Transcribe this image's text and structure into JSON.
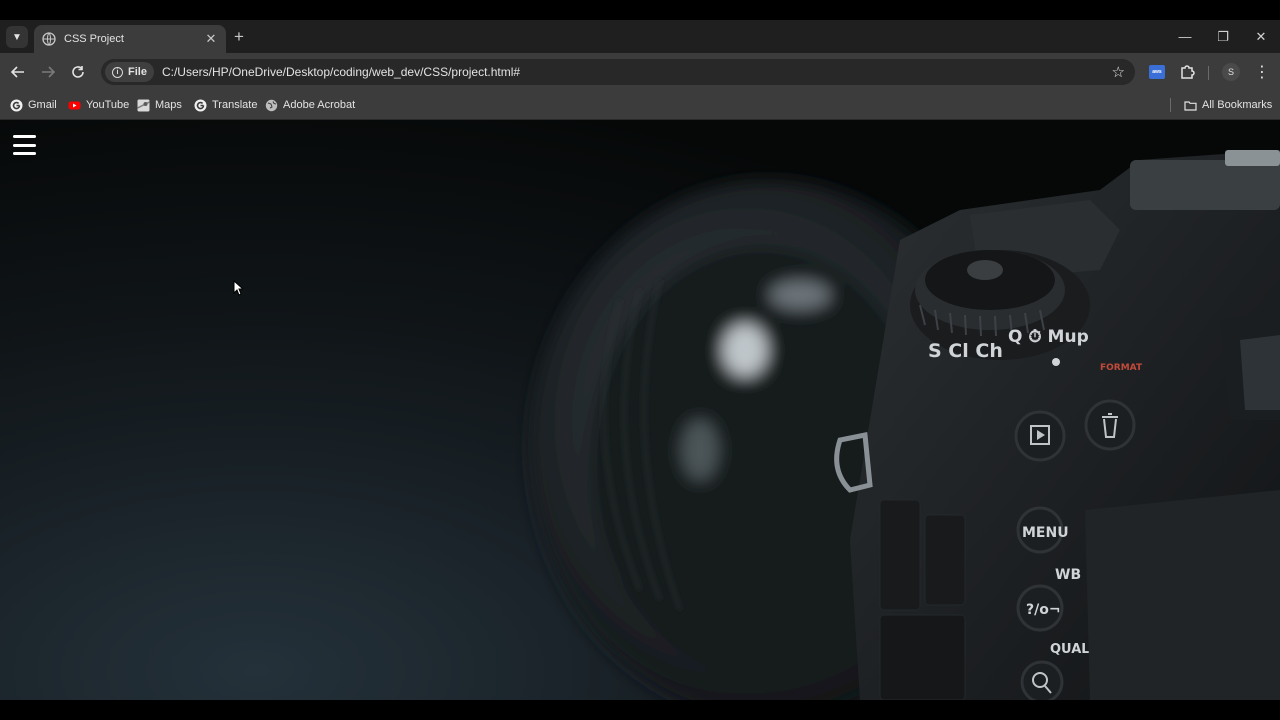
{
  "browser": {
    "tab": {
      "title": "CSS Project"
    },
    "address": {
      "scheme_chip": "File",
      "url": "C:/Users/HP/OneDrive/Desktop/coding/web_dev/CSS/project.html#"
    },
    "profile_initial": "S",
    "extension_label": "aws",
    "bookmarks": [
      {
        "label": "Gmail",
        "icon": "google-g-icon"
      },
      {
        "label": "YouTube",
        "icon": "youtube-icon"
      },
      {
        "label": "Maps",
        "icon": "maps-icon"
      },
      {
        "label": "Translate",
        "icon": "google-g-icon"
      },
      {
        "label": "Adobe Acrobat",
        "icon": "globe-icon"
      }
    ],
    "all_bookmarks": "All Bookmarks"
  },
  "camera_labels": {
    "dial_modes": "S  Cl Ch",
    "dial_right": "Q ⏱ Mup",
    "format": "FORMAT",
    "menu": "MENU",
    "wb": "WB",
    "help": "?/o¬",
    "qual": "QUAL"
  },
  "colors": {
    "tab_strip": "#1f1f1f",
    "toolbar": "#3c3c3c",
    "omnibox": "#282828",
    "accent_aws": "#3b6fd8"
  }
}
